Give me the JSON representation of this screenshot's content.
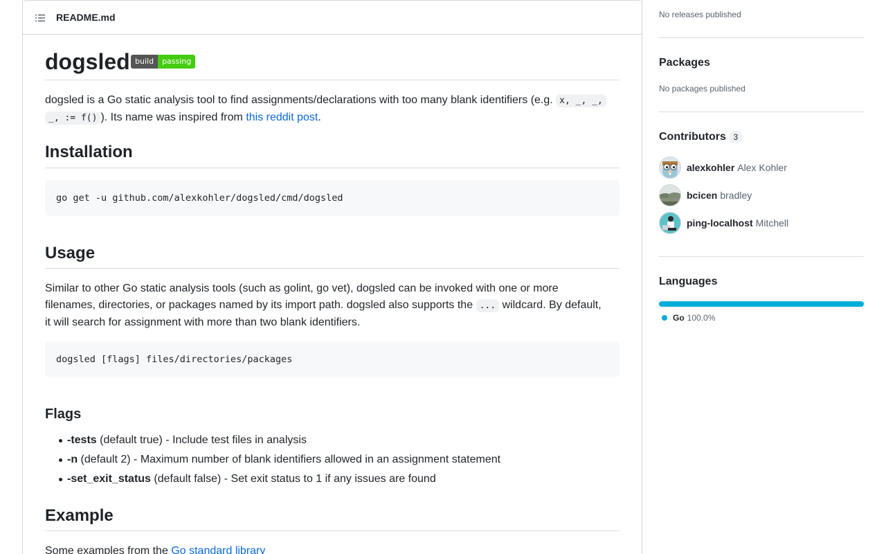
{
  "readme": {
    "filename": "README.md",
    "title": "dogsled",
    "badge": {
      "left": "build",
      "right": "passing",
      "right_color": "#44cc11"
    },
    "intro": {
      "text1": "dogsled is a Go static analysis tool to find assignments/declarations with too many blank identifiers (e.g.",
      "code1": "x, _, _,",
      "code2": "_, := f()",
      "text2": "). Its name was inspired from",
      "link": "this reddit post",
      "text3": "."
    },
    "installation": {
      "heading": "Installation",
      "code": "go get -u github.com/alexkohler/dogsled/cmd/dogsled"
    },
    "usage": {
      "heading": "Usage",
      "line1": "Similar to other Go static analysis tools (such as golint, go vet), dogsled can be invoked with one or more",
      "line2a": "filenames, directories, or packages named by its import path. dogsled also supports the",
      "line2code": "...",
      "line2b": "wildcard. By default,",
      "line3": "it will search for assignment with more than two blank identifiers.",
      "code": "dogsled [flags] files/directories/packages"
    },
    "flags": {
      "heading": "Flags",
      "items": [
        {
          "name": "-tests",
          "desc": " (default true) - Include test files in analysis"
        },
        {
          "name": "-n",
          "desc": " (default 2) - Maximum number of blank identifiers allowed in an assignment statement"
        },
        {
          "name": "-set_exit_status",
          "desc": " (default false) - Set exit status to 1 if any issues are found"
        }
      ]
    },
    "example": {
      "heading": "Example",
      "text": "Some examples from the",
      "link": "Go standard library"
    }
  },
  "sidebar": {
    "releases_text": "No releases published",
    "packages": {
      "heading": "Packages",
      "text": "No packages published"
    },
    "contributors": {
      "heading": "Contributors",
      "count": "3",
      "items": [
        {
          "login": "alexkohler",
          "name": "Alex Kohler",
          "avatar_icon": "gopher-avatar"
        },
        {
          "login": "bcicen",
          "name": "bradley",
          "avatar_icon": "landscape-avatar"
        },
        {
          "login": "ping-localhost",
          "name": "Mitchell",
          "avatar_icon": "person-avatar"
        }
      ]
    },
    "languages": {
      "heading": "Languages",
      "items": [
        {
          "name": "Go",
          "percent": "100.0%",
          "color": "#00ADD8"
        }
      ]
    }
  }
}
